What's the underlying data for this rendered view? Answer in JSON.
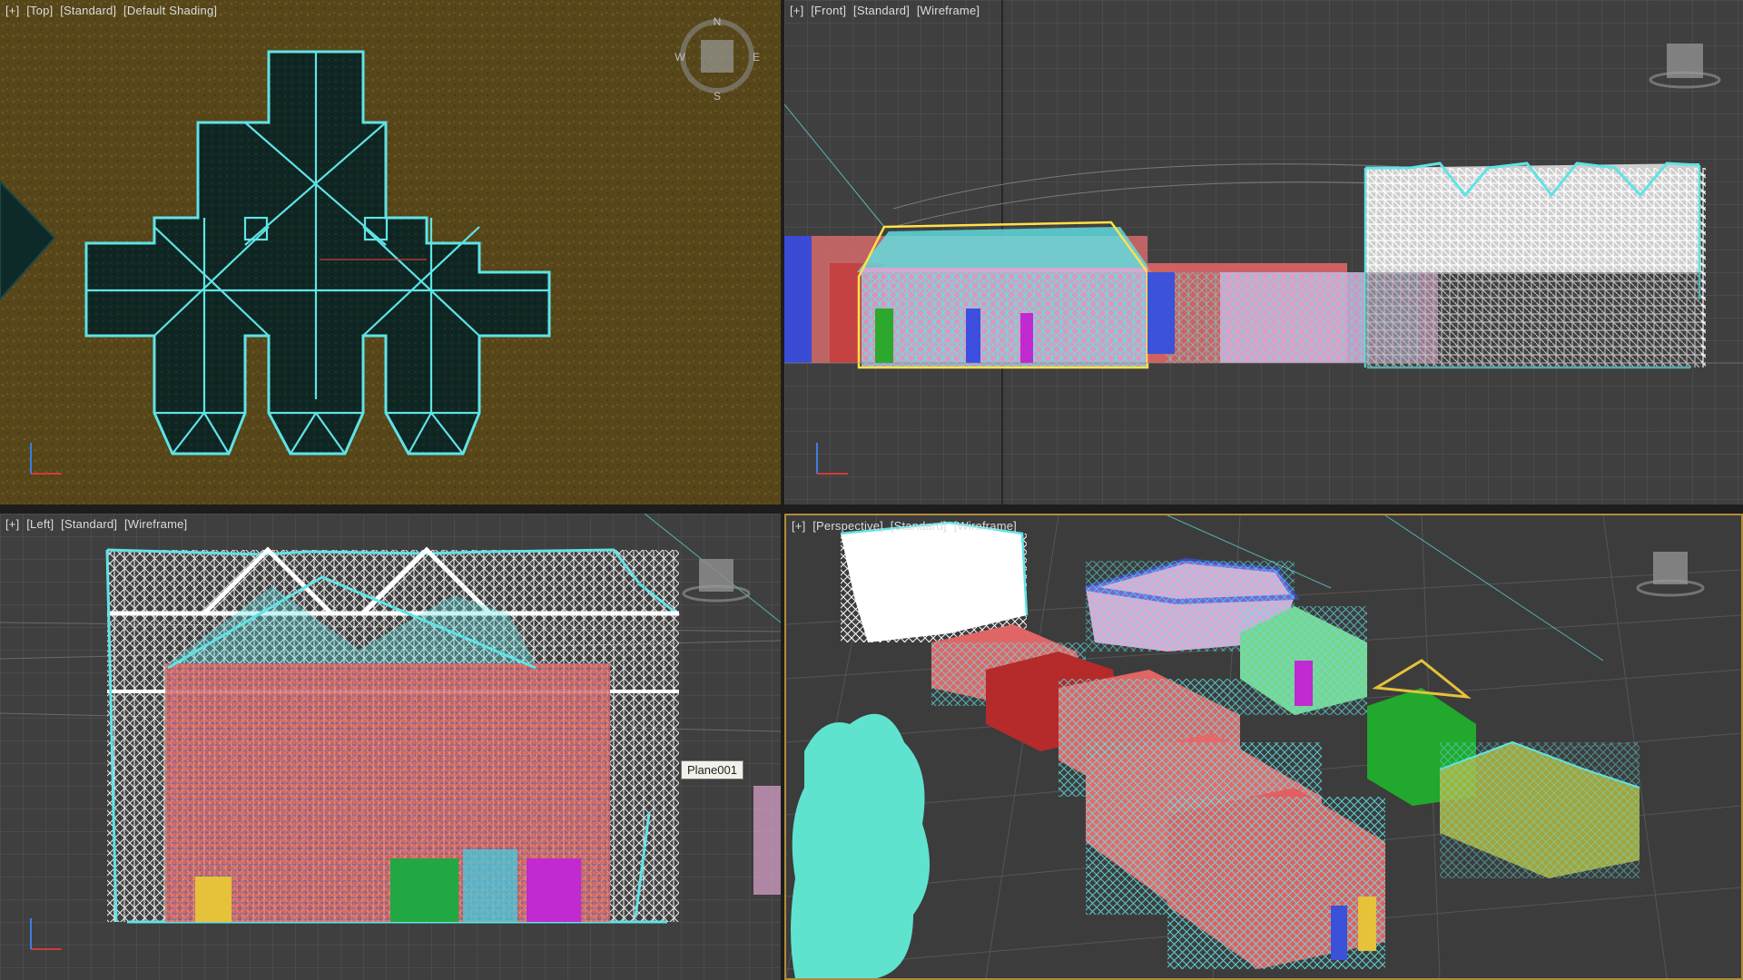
{
  "viewports": {
    "top": {
      "labels": [
        "[+]",
        "[Top]",
        "[Standard]",
        "[Default Shading]"
      ]
    },
    "front": {
      "labels": [
        "[+]",
        "[Front]",
        "[Standard]",
        "[Wireframe]"
      ]
    },
    "left": {
      "labels": [
        "[+]",
        "[Left]",
        "[Standard]",
        "[Wireframe]"
      ]
    },
    "persp": {
      "labels": [
        "[+]",
        "[Perspective]",
        "[Standard]",
        "[Wireframe]"
      ]
    }
  },
  "compass": {
    "n": "N",
    "s": "S",
    "e": "E",
    "w": "W"
  },
  "tooltip": {
    "text": "Plane001"
  },
  "colors": {
    "selection": "#5fe3e6",
    "grid": "#4e4e4e",
    "background_wire": "#3a3a3a",
    "ground_texture": "#5a4a1c",
    "roof_dark": "#0f2a26",
    "active_border": "#b08c3a"
  },
  "icons": [
    "viewcube-icon",
    "compass-icon",
    "axis-tripod-icon"
  ]
}
